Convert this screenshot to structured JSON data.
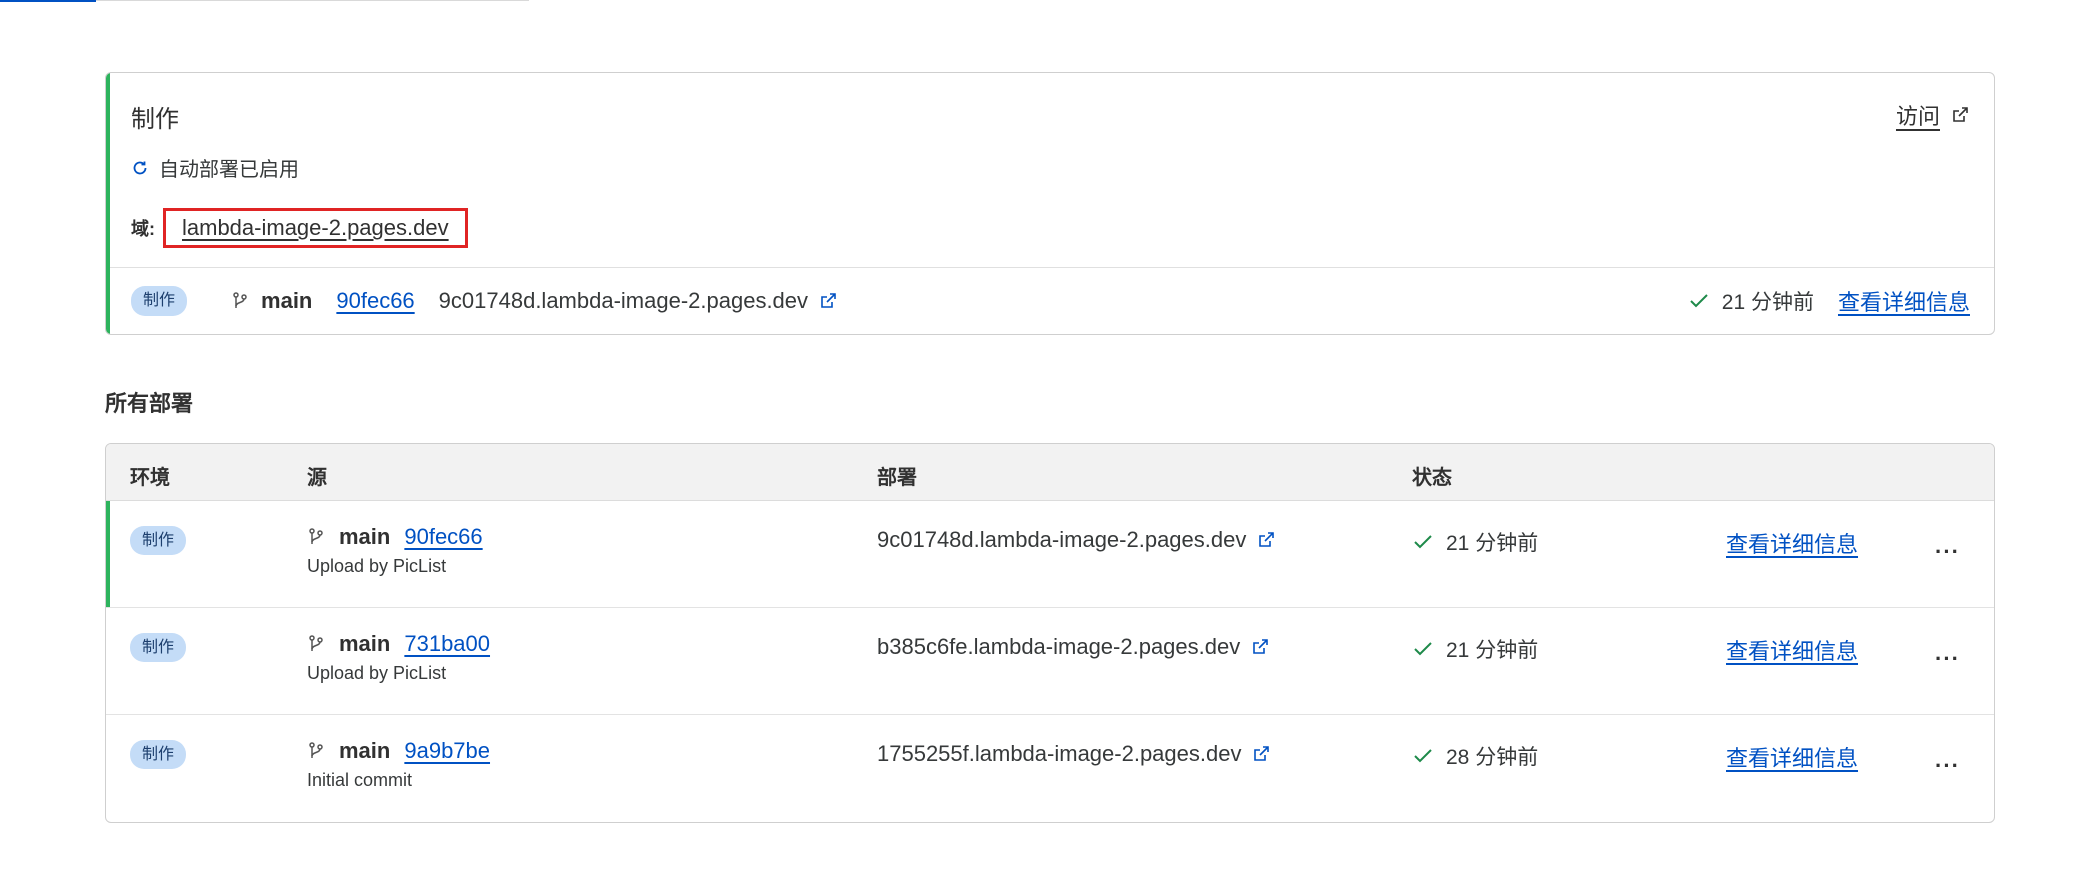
{
  "production": {
    "title": "制作",
    "visit_label": "访问",
    "auto_deploy_text": "自动部署已启用",
    "domain_label": "域:",
    "domain_value": "lambda-image-2.pages.dev",
    "latest": {
      "env_badge": "制作",
      "branch": "main",
      "commit": "90fec66",
      "url": "9c01748d.lambda-image-2.pages.dev",
      "status_time": "21 分钟前",
      "details_label": "查看详细信息"
    }
  },
  "all_deployments": {
    "title": "所有部署",
    "columns": [
      "环境",
      "源",
      "部署",
      "状态"
    ],
    "rows": [
      {
        "env": "制作",
        "branch": "main",
        "commit": "90fec66",
        "message": "Upload by PicList",
        "url": "9c01748d.lambda-image-2.pages.dev",
        "status_time": "21 分钟前",
        "details_label": "查看详细信息",
        "more": "···",
        "current": true
      },
      {
        "env": "制作",
        "branch": "main",
        "commit": "731ba00",
        "message": "Upload by PicList",
        "url": "b385c6fe.lambda-image-2.pages.dev",
        "status_time": "21 分钟前",
        "details_label": "查看详细信息",
        "more": "···",
        "current": false
      },
      {
        "env": "制作",
        "branch": "main",
        "commit": "9a9b7be",
        "message": "Initial commit",
        "url": "1755255f.lambda-image-2.pages.dev",
        "status_time": "28 分钟前",
        "details_label": "查看详细信息",
        "more": "···",
        "current": false
      }
    ]
  },
  "icons": {
    "branch": "git-branch-icon",
    "external": "external-link-icon",
    "check": "check-icon",
    "refresh": "refresh-icon",
    "more": "more-horizontal-icon"
  },
  "colors": {
    "accent_green": "#2db35d",
    "link_blue": "#0051c3",
    "badge_bg": "#c4dcf7",
    "highlight_red": "#e02424"
  }
}
